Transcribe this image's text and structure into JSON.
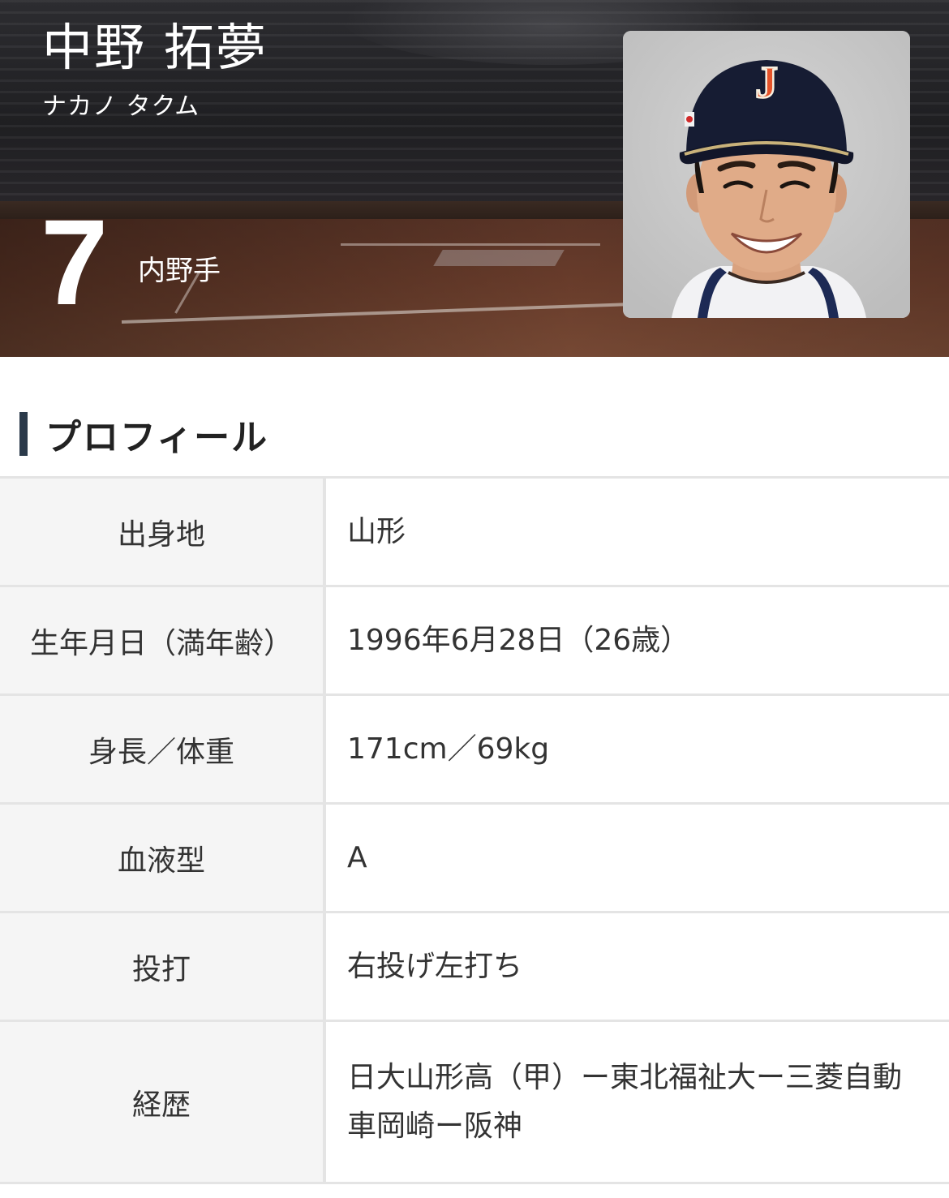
{
  "header": {
    "name": "中野 拓夢",
    "kana": "ナカノ タクム",
    "number": "7",
    "position": "内野手"
  },
  "section": {
    "title": "プロフィール"
  },
  "profile": {
    "rows": [
      {
        "label": "出身地",
        "value": "山形"
      },
      {
        "label": "生年月日（満年齢）",
        "value": "1996年6月28日（26歳）"
      },
      {
        "label": "身長／体重",
        "value": "171cm／69kg"
      },
      {
        "label": "血液型",
        "value": "A"
      },
      {
        "label": "投打",
        "value": "右投げ左打ち"
      },
      {
        "label": "経歴",
        "value": "日大山形高（甲）ー東北福祉大ー三菱自動車岡崎ー阪神"
      }
    ]
  },
  "photo": {
    "cap_letter": "J"
  },
  "colors": {
    "heading_accent": "#2b3a4a",
    "label_bg": "#f5f5f5",
    "border": "#e4e4e4",
    "cap_navy": "#161c33",
    "cap_logo": "#e5532a"
  }
}
